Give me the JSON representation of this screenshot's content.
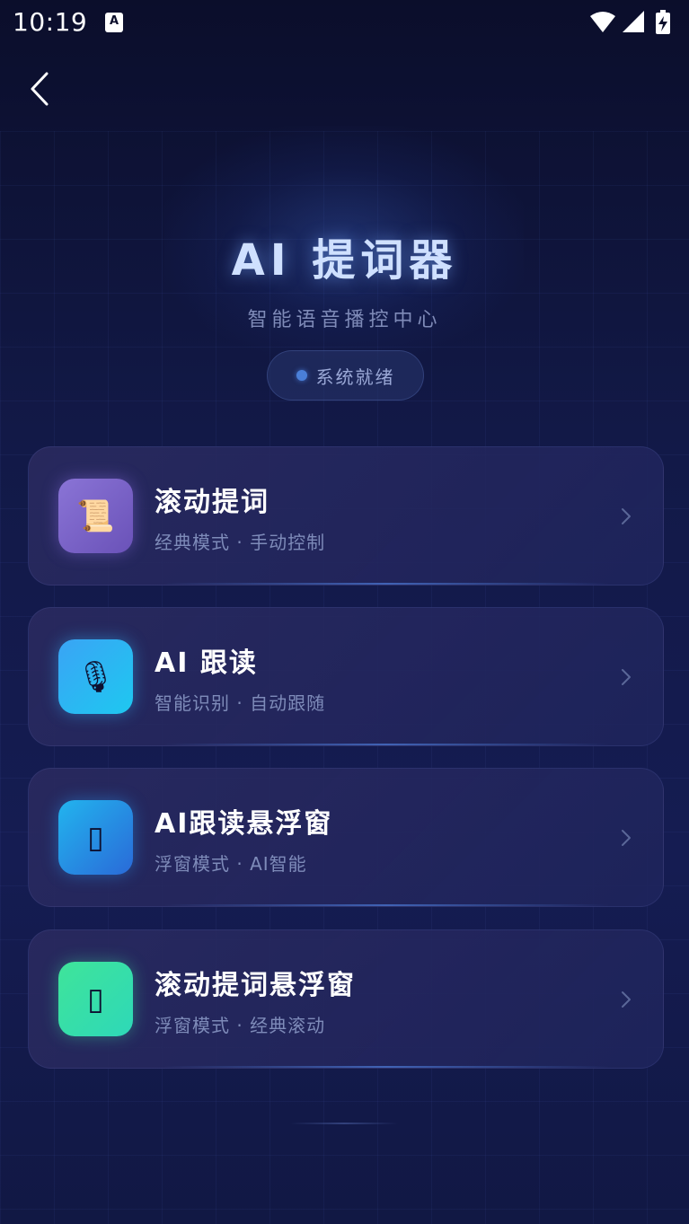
{
  "status_bar": {
    "time": "10:19",
    "notification_icon": "A",
    "icons": [
      "wifi-icon",
      "signal-icon",
      "battery-charging-icon"
    ]
  },
  "nav": {
    "back_icon": "chevron-left-icon"
  },
  "hero": {
    "title": "AI 提词器",
    "subtitle": "智能语音播控中心",
    "status": "系统就绪",
    "status_color": "#4a7fd8"
  },
  "cards": [
    {
      "title": "滚动提词",
      "subtitle": "经典模式 · 手动控制",
      "icon": "scroll-icon",
      "icon_glyph": "📜",
      "icon_gradient": [
        "#8a74d6",
        "#6a52b8"
      ]
    },
    {
      "title": "AI 跟读",
      "subtitle": "智能识别 · 自动跟随",
      "icon": "microphone-icon",
      "icon_glyph": "🎙",
      "icon_gradient": [
        "#3aa4f5",
        "#1ec8f0"
      ]
    },
    {
      "title": "AI跟读悬浮窗",
      "subtitle": "浮窗模式 · AI智能",
      "icon": "window-icon",
      "icon_glyph": "▯",
      "icon_gradient": [
        "#22b4ee",
        "#2a6ad8"
      ]
    },
    {
      "title": "滚动提词悬浮窗",
      "subtitle": "浮窗模式 · 经典滚动",
      "icon": "window-icon",
      "icon_glyph": "▯",
      "icon_gradient": [
        "#3fe49a",
        "#2ed8b8"
      ]
    }
  ],
  "colors": {
    "background": "#121947",
    "accent": "#4a7fd8",
    "title": "#cfe0ff"
  }
}
